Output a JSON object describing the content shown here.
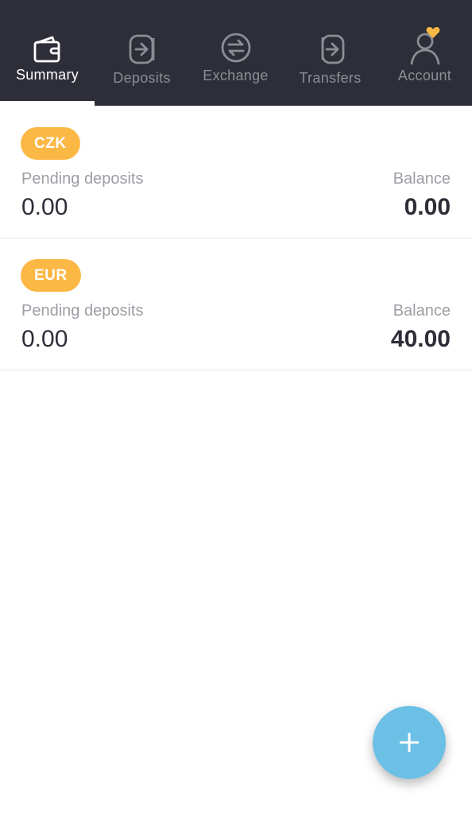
{
  "nav": {
    "tabs": [
      {
        "label": "Summary",
        "icon": "wallet-icon",
        "active": true
      },
      {
        "label": "Deposits",
        "icon": "deposit-arrow-icon",
        "active": false
      },
      {
        "label": "Exchange",
        "icon": "exchange-arrows-icon",
        "active": false
      },
      {
        "label": "Transfers",
        "icon": "transfer-arrow-icon",
        "active": false
      },
      {
        "label": "Account",
        "icon": "user-icon",
        "active": false,
        "badge_icon": "heart-icon"
      }
    ]
  },
  "currencies": [
    {
      "code": "CZK",
      "pending_label": "Pending deposits",
      "pending_value": "0.00",
      "balance_label": "Balance",
      "balance_value": "0.00"
    },
    {
      "code": "EUR",
      "pending_label": "Pending deposits",
      "pending_value": "0.00",
      "balance_label": "Balance",
      "balance_value": "40.00"
    }
  ],
  "fab": {
    "icon": "plus-icon"
  },
  "colors": {
    "nav_bg": "#2d2e37",
    "badge": "#fcb845",
    "fab": "#6cc0e6",
    "heart": "#fcb845"
  }
}
